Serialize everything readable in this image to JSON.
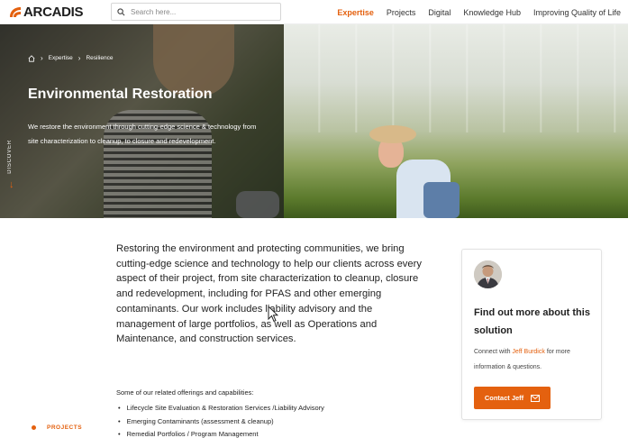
{
  "header": {
    "logo_text": "ARCADIS",
    "search_placeholder": "Search here...",
    "nav": [
      "Expertise",
      "Projects",
      "Digital",
      "Knowledge Hub",
      "Improving Quality of Life"
    ],
    "active_nav": "Expertise"
  },
  "hero": {
    "breadcrumb": [
      "Expertise",
      "Resilience"
    ],
    "title": "Environmental Restoration",
    "description": "We restore the environment through cutting-edge science & technology from site characterization to cleanup, to closure and redevelopment.",
    "discover_label": "DISCOVER"
  },
  "main": {
    "intro": "Restoring the environment and protecting communities, we bring cutting-edge science and technology to help our clients across every aspect of their project, from site characterization to cleanup, closure and redevelopment, including for PFAS and other emerging contaminants. Our work includes liability advisory and the management of large portfolios, as well as Operations and Maintenance, and construction services.",
    "offerings_heading": "Some of our related offerings and capabilities:",
    "offerings": [
      "Lifecycle Site Evaluation & Restoration Services /Liability Advisory",
      "Emerging Contaminants (assessment & cleanup)",
      "Remedial Portfolios / Program Management"
    ],
    "projects_label": "PROJECTS"
  },
  "contact_card": {
    "title": "Find out more about this solution",
    "text_before": "Connect with ",
    "contact_name": "Jeff Burdick",
    "text_after": " for more information & questions.",
    "button_label": "Contact Jeff"
  },
  "colors": {
    "accent": "#e4610f",
    "text": "#222222"
  }
}
